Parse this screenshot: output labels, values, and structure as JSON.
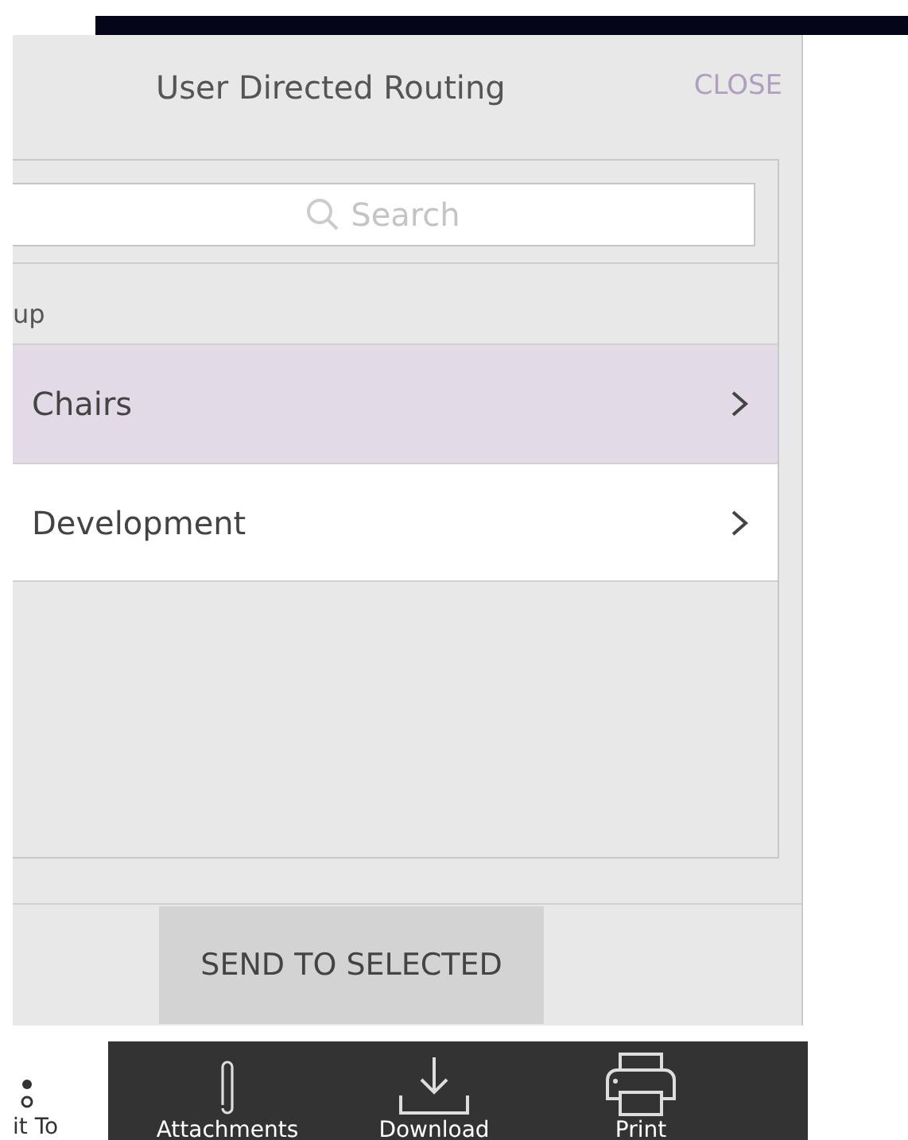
{
  "header": {
    "title": "User Directed Routing",
    "close": "CLOSE"
  },
  "search": {
    "placeholder": "Search"
  },
  "group_label": "up",
  "items": [
    {
      "label": "Chairs",
      "selected": true
    },
    {
      "label": "Development",
      "selected": false
    }
  ],
  "send_button": "SEND TO SELECTED",
  "toolbar": [
    {
      "kind": "dots",
      "label": "it To"
    },
    {
      "kind": "attachments",
      "label": "Attachments"
    },
    {
      "kind": "download",
      "label": "Download"
    },
    {
      "kind": "print",
      "label": "Print"
    }
  ]
}
